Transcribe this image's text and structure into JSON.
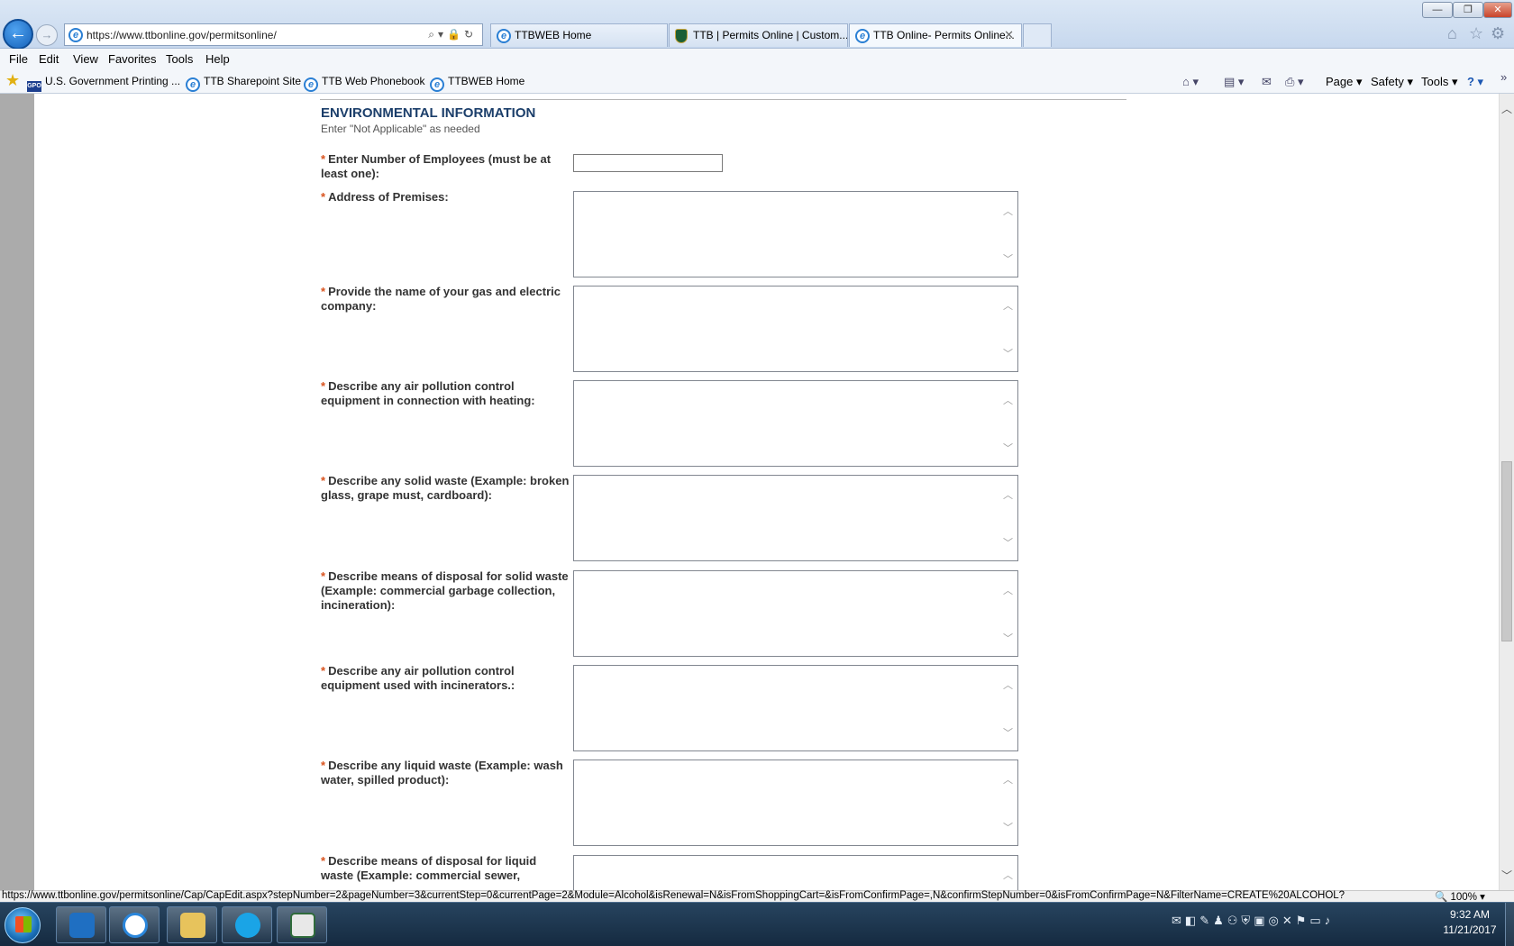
{
  "browser": {
    "address": "https://www.ttbonline.gov/permitsonline/",
    "tabs": [
      {
        "label": "TTBWEB Home"
      },
      {
        "label": "TTB | Permits Online | Custom..."
      },
      {
        "label": "TTB Online- Permits Online..."
      }
    ],
    "window_buttons": {
      "minimize": "—",
      "restore": "❐",
      "close": "✕"
    },
    "menu": [
      "File",
      "Edit",
      "View",
      "Favorites",
      "Tools",
      "Help"
    ],
    "favorites": [
      {
        "label": "U.S. Government Printing ...",
        "icon": "gpo-icon"
      },
      {
        "label": "TTB Sharepoint Site",
        "icon": "ie-page-icon"
      },
      {
        "label": "TTB Web Phonebook",
        "icon": "ie-page-icon"
      },
      {
        "label": "TTBWEB Home",
        "icon": "ie-page-icon"
      }
    ],
    "command_bar": {
      "page": "Page ▾",
      "safety": "Safety ▾",
      "tools": "Tools ▾",
      "help": "? ▾"
    }
  },
  "form": {
    "section_title": "ENVIRONMENTAL INFORMATION",
    "section_hint": "Enter \"Not Applicable\" as needed",
    "required_marker": "*",
    "employees_label": "Enter Number of Employees (must be at least one):",
    "employees_value": "",
    "textareas": [
      {
        "label": "Address of Premises:",
        "value": ""
      },
      {
        "label": "Provide the name of your gas and electric company:",
        "value": ""
      },
      {
        "label": "Describe any air pollution control equipment in connection with heating:",
        "value": ""
      },
      {
        "label": "Describe any solid waste (Example: broken glass, grape must, cardboard):",
        "value": ""
      },
      {
        "label": "Describe means of disposal for solid waste (Example: commercial garbage collection, incineration):",
        "value": ""
      },
      {
        "label": "Describe any air pollution control equipment used with incinerators.:",
        "value": ""
      },
      {
        "label": "Describe any liquid waste (Example: wash water, spilled product):",
        "value": ""
      },
      {
        "label": "Describe means of disposal for liquid waste (Example: commercial sewer,",
        "value": ""
      }
    ]
  },
  "status": {
    "url": "https://www.ttbonline.gov/permitsonline/Cap/CapEdit.aspx?stepNumber=2&pageNumber=3&currentStep=0&currentPage=2&Module=Alcohol&isRenewal=N&isFromShoppingCart=&isFromConfirmPage=,N&confirmStepNumber=0&isFromConfirmPage=N&FilterName=CREATE%20ALCOHOL?",
    "zoom": "🔍 100% ▾"
  },
  "taskbar": {
    "apps": [
      "outlook-icon",
      "internet-explorer-icon",
      "file-explorer-icon",
      "skype-icon",
      "notes-icon"
    ],
    "time": "9:32 AM",
    "date": "11/21/2017"
  }
}
